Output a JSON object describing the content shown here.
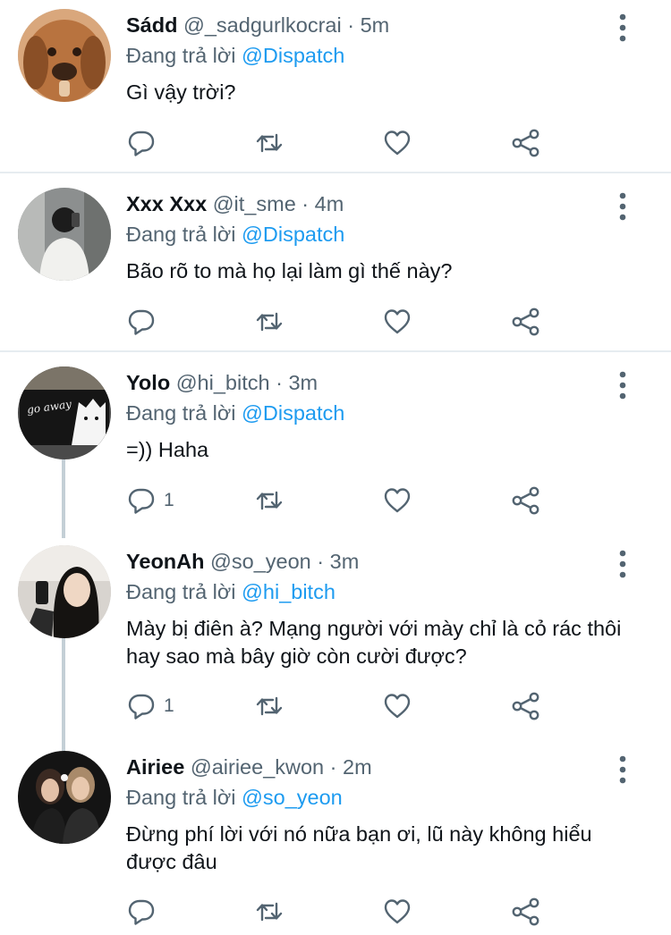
{
  "reply_prefix": "Đang trả lời",
  "tweets": [
    {
      "name": "Sádd",
      "handle": "@_sadgurlkocrai",
      "time": "5m",
      "reply_to": "@Dispatch",
      "text": "Gì vậy trời?",
      "reply_count": ""
    },
    {
      "name": "Xxx Xxx",
      "handle": "@it_sme",
      "time": "4m",
      "reply_to": "@Dispatch",
      "text": "Bão rõ to mà họ lại làm gì thế này?",
      "reply_count": ""
    },
    {
      "name": "Yolo",
      "handle": "@hi_bitch",
      "time": "3m",
      "reply_to": "@Dispatch",
      "text": "=)) Haha",
      "reply_count": "1",
      "avatar_text": "go away"
    },
    {
      "name": "YeonAh",
      "handle": "@so_yeon",
      "time": "3m",
      "reply_to": "@hi_bitch",
      "text": "Mày bị điên à? Mạng người với mày chỉ là cỏ rác thôi hay sao mà bây giờ còn cười được?",
      "reply_count": "1"
    },
    {
      "name": "Airiee",
      "handle": "@airiee_kwon",
      "time": "2m",
      "reply_to": "@so_yeon",
      "text": "Đừng phí lời với nó nữa bạn ơi, lũ này không hiểu được đâu",
      "reply_count": ""
    }
  ],
  "icons": {
    "reply": "reply-icon",
    "retweet": "retweet-icon",
    "like": "like-icon",
    "share": "share-icon",
    "more": "more-options-icon"
  },
  "colors": {
    "mention": "#1d9bf0",
    "secondary_text": "#536471",
    "thread_line": "#c4cfd6",
    "divider": "#e6ecf0"
  }
}
